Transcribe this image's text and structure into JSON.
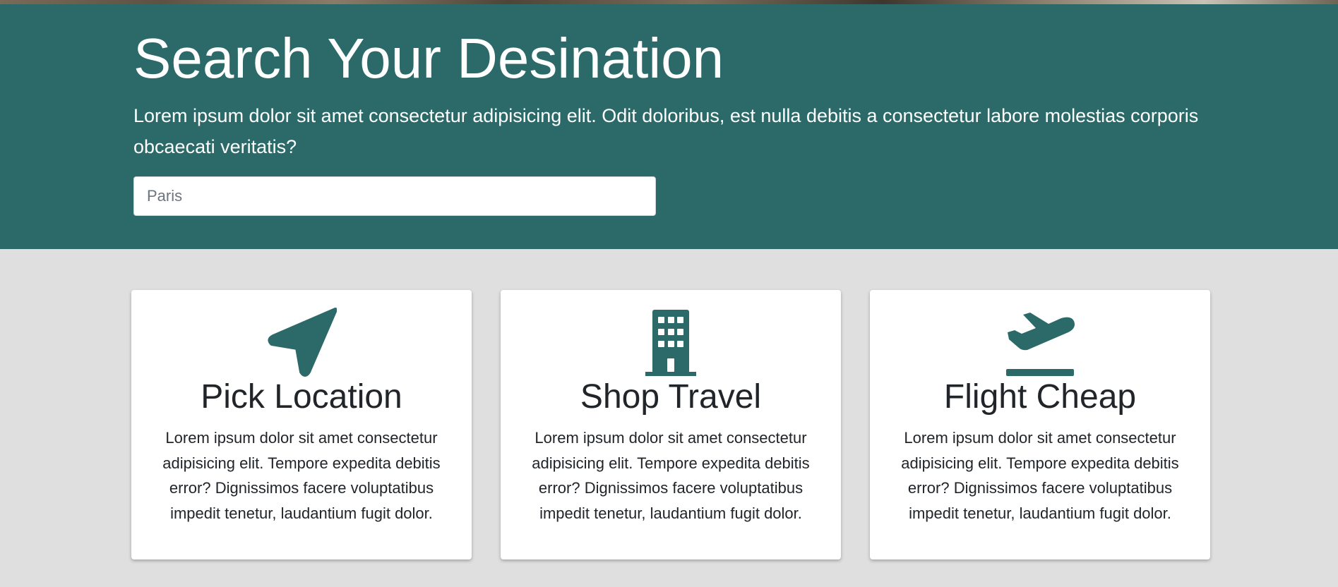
{
  "hero": {
    "title": "Search Your Desination",
    "text": "Lorem ipsum dolor sit amet consectetur adipisicing elit. Odit doloribus, est nulla debitis a consectetur labore molestias corporis obcaecati veritatis?",
    "search": {
      "placeholder": "Paris",
      "value": ""
    }
  },
  "cards": [
    {
      "icon": "location-arrow-icon",
      "title": "Pick Location",
      "text": "Lorem ipsum dolor sit amet consectetur adipisicing elit. Tempore expedita debitis error? Dignissimos facere voluptatibus impedit tenetur, laudantium fugit dolor."
    },
    {
      "icon": "building-icon",
      "title": "Shop Travel",
      "text": "Lorem ipsum dolor sit amet consectetur adipisicing elit. Tempore expedita debitis error? Dignissimos facere voluptatibus impedit tenetur, laudantium fugit dolor."
    },
    {
      "icon": "plane-departure-icon",
      "title": "Flight Cheap",
      "text": "Lorem ipsum dolor sit amet consectetur adipisicing elit. Tempore expedita debitis error? Dignissimos facere voluptatibus impedit tenetur, laudantium fugit dolor."
    }
  ],
  "colors": {
    "accent": "#2c6a6a",
    "page_background": "#dfdfdf",
    "card_background": "#ffffff",
    "text": "#212529"
  }
}
